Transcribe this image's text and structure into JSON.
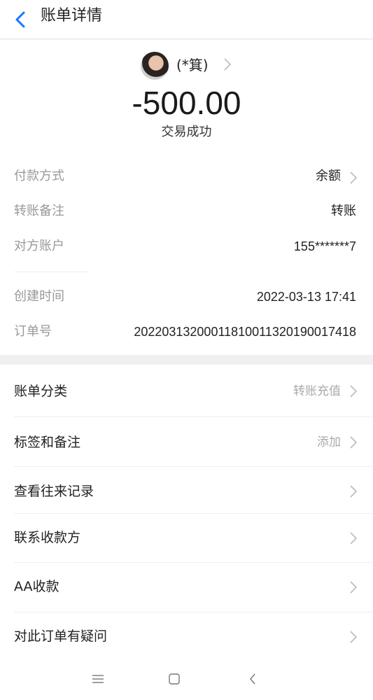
{
  "header": {
    "title": "账单详情"
  },
  "payee": {
    "name": "(*箕)"
  },
  "summary": {
    "amount": "-500.00",
    "status": "交易成功"
  },
  "details": [
    {
      "key": "付款方式",
      "value": "余额",
      "chevron": true
    },
    {
      "key": "转账备注",
      "value": "转账",
      "chevron": false
    },
    {
      "key": "对方账户",
      "value": "155*******7",
      "chevron": false
    },
    {
      "key": "创建时间",
      "value": "2022-03-13 17:41",
      "chevron": false
    },
    {
      "key": "订单号",
      "value": "20220313200011810011320190017418",
      "chevron": false
    }
  ],
  "actions": [
    {
      "label": "账单分类",
      "hint": "转账充值"
    },
    {
      "label": "标签和备注",
      "hint": "添加"
    },
    {
      "label": "查看往来记录",
      "hint": ""
    },
    {
      "label": "联系收款方",
      "hint": ""
    },
    {
      "label": "AA收款",
      "hint": ""
    },
    {
      "label": "对此订单有疑问",
      "hint": ""
    }
  ],
  "icons": {
    "back": "back-arrow-icon",
    "chevron": "chevron-right-icon",
    "menu": "menu-icon",
    "home": "home-icon",
    "nav_back": "nav-back-icon"
  },
  "colors": {
    "accent": "#1677ff"
  }
}
